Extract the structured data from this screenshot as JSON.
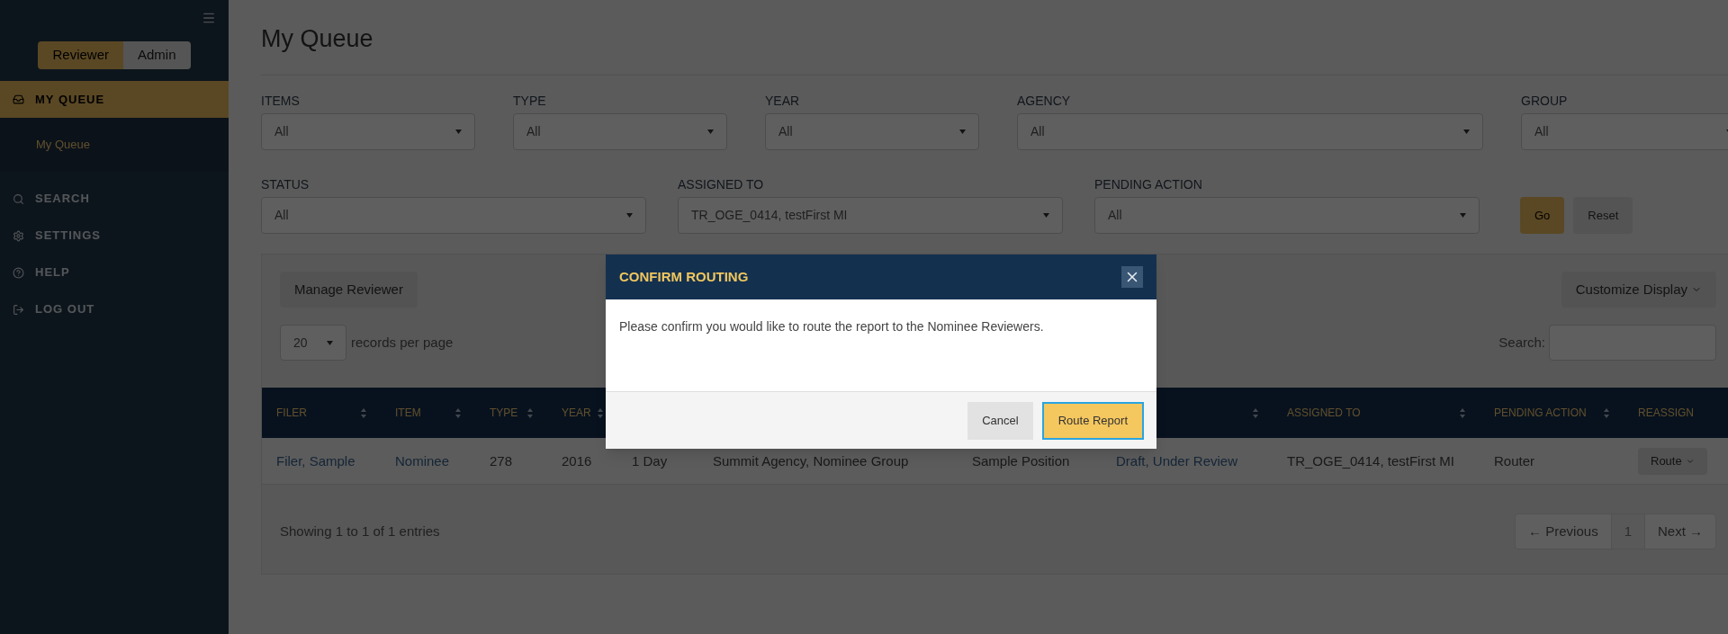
{
  "sidebar": {
    "roles": [
      {
        "label": "Reviewer",
        "selected": true
      },
      {
        "label": "Admin",
        "selected": false
      }
    ],
    "nav": [
      {
        "label": "MY QUEUE",
        "selected": true,
        "children": [
          {
            "label": "My Queue"
          }
        ]
      },
      {
        "label": "SEARCH",
        "selected": false
      },
      {
        "label": "SETTINGS",
        "selected": false
      },
      {
        "label": "HELP",
        "selected": false
      },
      {
        "label": "LOG OUT",
        "selected": false
      }
    ]
  },
  "page_title": "My Queue",
  "filters_row_1": [
    {
      "label": "ITEMS",
      "value": "All"
    },
    {
      "label": "TYPE",
      "value": "All"
    },
    {
      "label": "YEAR",
      "value": "All"
    },
    {
      "label": "AGENCY",
      "value": "All"
    },
    {
      "label": "GROUP",
      "value": "All"
    }
  ],
  "filters_row_2": [
    {
      "label": "STATUS",
      "value": "All"
    },
    {
      "label": "ASSIGNED TO",
      "value": "TR_OGE_0414, testFirst MI"
    },
    {
      "label": "PENDING ACTION",
      "value": "All"
    }
  ],
  "filter_buttons": [
    "Go",
    "Reset"
  ],
  "manage_button": "Manage Reviewer",
  "customize_button": "Customize Display",
  "page_size": {
    "value": "20",
    "label": "records per page"
  },
  "search_label": "Search:",
  "table": {
    "columns": [
      {
        "label": "FILER",
        "sortable": true
      },
      {
        "label": "ITEM",
        "sortable": true
      },
      {
        "label": "TYPE",
        "sortable": true
      },
      {
        "label": "YEAR",
        "sortable": true
      },
      null,
      null,
      null,
      {
        "sortable": true
      },
      {
        "label": "ASSIGNED TO",
        "sortable": true
      },
      {
        "label": "PENDING ACTION",
        "sortable": true
      },
      {
        "label": "REASSIGN",
        "sortable": false
      }
    ],
    "rows": [
      [
        {
          "kind": "link",
          "text": "Filer, Sample"
        },
        {
          "kind": "link",
          "text": "Nominee"
        },
        {
          "kind": "text",
          "text": "278"
        },
        {
          "kind": "text",
          "text": "2016"
        },
        {
          "kind": "text",
          "text": "1 Day"
        },
        {
          "kind": "text",
          "text": "Summit Agency, Nominee Group"
        },
        {
          "kind": "text",
          "text": "Sample Position"
        },
        {
          "kind": "link",
          "text": "Draft, Under Review"
        },
        {
          "kind": "text",
          "text": "TR_OGE_0414, testFirst MI"
        },
        {
          "kind": "text",
          "text": "Router"
        },
        {
          "kind": "button",
          "text": "Route"
        }
      ]
    ]
  },
  "info": "Showing 1 to 1 of 1 entries",
  "pagination": {
    "previous": "← Previous",
    "pages": [
      {
        "label": "1",
        "selected": true
      }
    ],
    "next": "Next →"
  },
  "dialog": {
    "title": "CONFIRM ROUTING",
    "message": "Please confirm you would like to route the report to the Nominee Reviewers.",
    "buttons": [
      {
        "kind": "secondary",
        "label": "Cancel"
      },
      {
        "kind": "primary",
        "label": "Route Report"
      }
    ]
  }
}
